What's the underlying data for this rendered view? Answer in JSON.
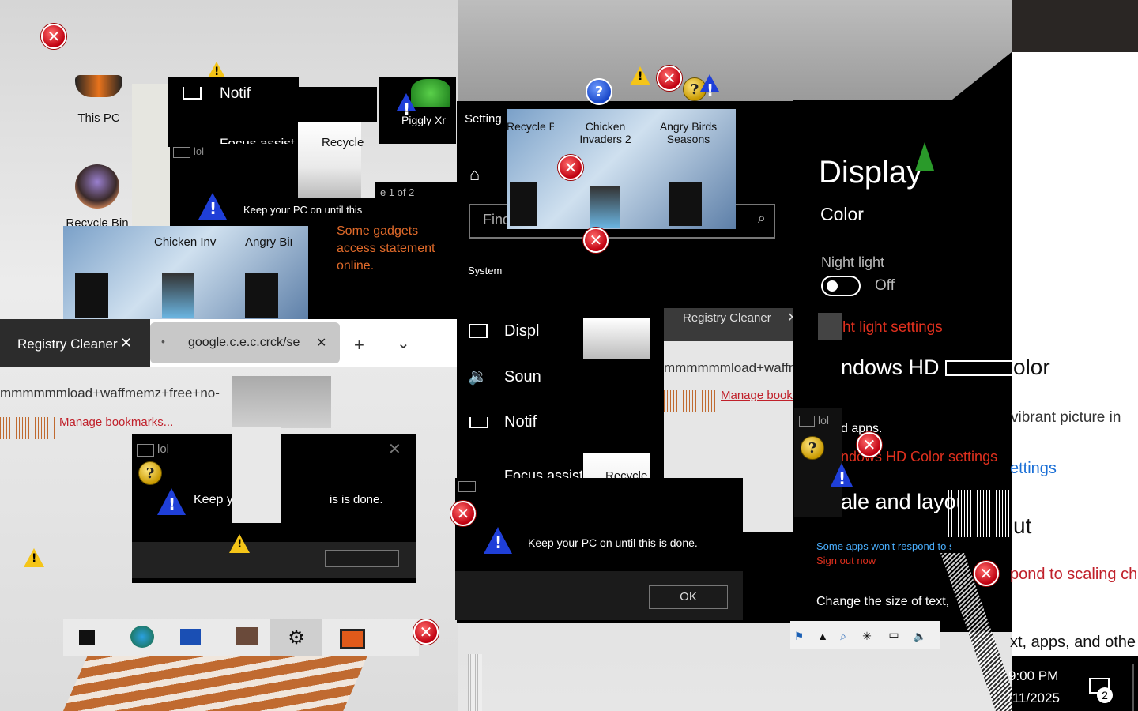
{
  "desktop": {
    "icons": [
      {
        "label": "This PC"
      },
      {
        "label": "Recycle  Bin"
      },
      {
        "label": "Chicken Invaders 2"
      },
      {
        "label": "Angry Birds Seasons"
      },
      {
        "label": "Recycle"
      },
      {
        "label": "Piggly Xr"
      }
    ]
  },
  "notif_fragment": {
    "label": "Notif"
  },
  "focus_fragment": {
    "label": "Focus assist"
  },
  "small_window_title": "lol",
  "keep_pc_text": "Keep your PC on until this",
  "keep_pc_text_2": "Keep your PC on until this is done.",
  "keep_y_text": "Keep y",
  "done_text": "is is done.",
  "gadgets_text": "Some gadgets access statement online.",
  "page_indicator": "e 1 of 2",
  "browser": {
    "tabs": [
      {
        "label": "Registry Cleaner"
      },
      {
        "label": "google.c.e.c.crck/se"
      }
    ],
    "new_tab": "+",
    "menu": "⌄",
    "address_fragment": "mmmmmmload+waffmemz+free+no-",
    "address_fragment_2": "mmmmmmload+waffmemz+f",
    "manage_bookmarks": "Manage bookmarks..."
  },
  "settings": {
    "title_fragment": "Setting",
    "find_placeholder": "Find",
    "system_label": "System",
    "nav": [
      {
        "label": "Displ",
        "icon": "monitor-icon"
      },
      {
        "label": "Soun",
        "icon": "speaker-icon"
      },
      {
        "label": "Notif",
        "icon": "notification-icon"
      },
      {
        "label": "Focus assist",
        "icon": "moon-icon"
      }
    ],
    "display_heading": "Display",
    "color_heading": "Color",
    "night_light_label": "Night light",
    "night_light_state": "Off",
    "night_light_settings": "ht light settings",
    "windows_hd_color": "ndows HD Color",
    "windows_hd_color_2": "olor",
    "hd_desc_1": "vibrant picture in",
    "hd_desc_2": "d apps.",
    "hd_settings_link": "ndows HD Color settings",
    "hd_settings_link_2": "ettings",
    "scale_heading": "ale and layout",
    "scale_heading_2": "ut",
    "some_apps_warn": "Some apps won't respond to scaling ch",
    "sign_out": "Sign out now",
    "respond_text": "pond to scaling ch",
    "change_size": "Change the size of text, apps, and other items",
    "text_apps": "xt, apps, and othe"
  },
  "registry_tab_2": "Registry Cleaner",
  "ok_label": "OK",
  "taskbar": {
    "time": "9:00 PM",
    "date": "/11/2025",
    "notification_count": "2"
  },
  "colors": {
    "accent_red": "#c0202a",
    "link_blue": "#1a6fd6",
    "settings_bg": "#000000",
    "browser_tab": "#3a3a3a"
  }
}
